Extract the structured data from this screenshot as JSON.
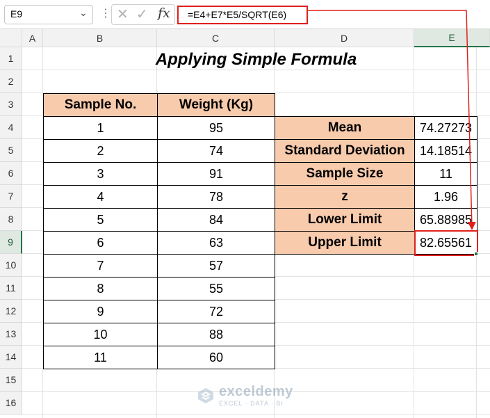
{
  "name_box": {
    "value": "E9"
  },
  "formula_bar": {
    "formula": "=E4+E7*E5/SQRT(E6)",
    "fx_label": "fx"
  },
  "columns": [
    "A",
    "B",
    "C",
    "D",
    "E"
  ],
  "rows": [
    "1",
    "2",
    "3",
    "4",
    "5",
    "6",
    "7",
    "8",
    "9",
    "10",
    "11",
    "12",
    "13",
    "14",
    "15",
    "16"
  ],
  "selected_cell": {
    "column": "E",
    "row": "9"
  },
  "title": "Applying Simple Formula",
  "sample_table": {
    "headers": [
      "Sample No.",
      "Weight (Kg)"
    ],
    "rows": [
      [
        "1",
        "95"
      ],
      [
        "2",
        "74"
      ],
      [
        "3",
        "91"
      ],
      [
        "4",
        "78"
      ],
      [
        "5",
        "84"
      ],
      [
        "6",
        "63"
      ],
      [
        "7",
        "57"
      ],
      [
        "8",
        "55"
      ],
      [
        "9",
        "72"
      ],
      [
        "10",
        "88"
      ],
      [
        "11",
        "60"
      ]
    ]
  },
  "stats_table": {
    "rows": [
      [
        "Mean",
        "74.27273"
      ],
      [
        "Standard Deviation",
        "14.18514"
      ],
      [
        "Sample Size",
        "11"
      ],
      [
        "z",
        "1.96"
      ],
      [
        "Lower Limit",
        "65.88985"
      ],
      [
        "Upper Limit",
        "82.65561"
      ]
    ]
  },
  "watermark": {
    "name": "exceldemy",
    "tagline": "EXCEL · DATA · BI"
  },
  "colors": {
    "header_fill": "#f8cbad",
    "highlight": "#e0201b",
    "excel_green": "#217346"
  }
}
